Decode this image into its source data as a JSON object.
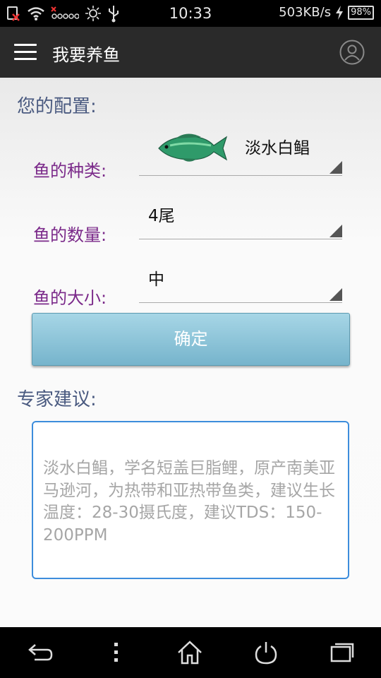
{
  "status_bar": {
    "time": "10:33",
    "network_speed": "503KB/s",
    "battery_percent": "98%",
    "icons": [
      "sim-error-icon",
      "wifi-icon",
      "signal-icon",
      "brightness-icon",
      "usb-icon",
      "charging-icon",
      "battery-icon"
    ]
  },
  "app_bar": {
    "title": "我要养鱼",
    "icons": [
      "menu-icon",
      "account-icon"
    ]
  },
  "config": {
    "heading": "您的配置:",
    "species": {
      "label": "鱼的种类:",
      "value": "淡水白鲳",
      "icon": "fish-thumbnail"
    },
    "count": {
      "label": "鱼的数量:",
      "value": "4尾"
    },
    "size": {
      "label": "鱼的大小:",
      "value": "中"
    },
    "confirm_label": "确定"
  },
  "advice": {
    "heading": "专家建议:",
    "text": "淡水白鲳，学名短盖巨脂鲤，原产南美亚马逊河，为热带和亚热带鱼类，建议生长温度：28-30摄氏度，建议TDS：150-200PPM"
  },
  "nav_bar": {
    "icons": [
      "back-icon",
      "menu-dots-icon",
      "home-icon",
      "power-icon",
      "recents-icon"
    ]
  },
  "colors": {
    "app_bar": "#2a2a2a",
    "label_purple": "#7b2a8a",
    "heading_blue": "#4a5a80",
    "button_blue": "#8ec6da",
    "advice_border": "#3d8ddc"
  }
}
